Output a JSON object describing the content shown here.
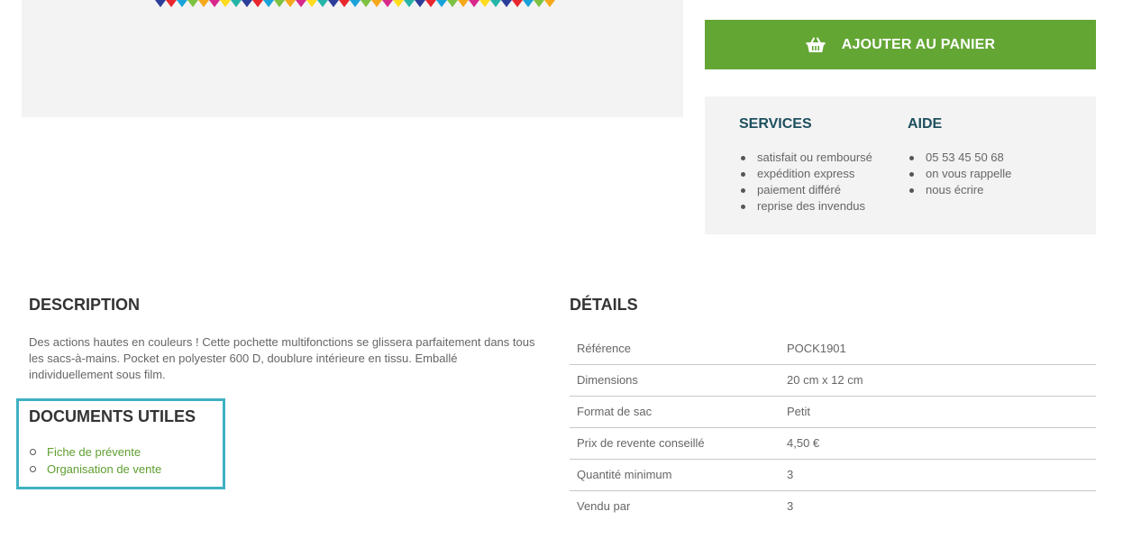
{
  "cart": {
    "label": "AJOUTER AU PANIER",
    "icon": "basket-icon"
  },
  "services": {
    "title": "SERVICES",
    "items": [
      "satisfait ou remboursé",
      "expédition express",
      "paiement différé",
      "reprise des invendus"
    ]
  },
  "aide": {
    "title": "AIDE",
    "items": [
      "05 53 45 50 68",
      "on vous rappelle",
      "nous écrire"
    ]
  },
  "description": {
    "title": "DESCRIPTION",
    "text": "Des actions hautes en couleurs ! Cette pochette multifonctions se glissera parfaitement dans tous les sacs-à-mains. Pocket en polyester 600 D, doublure intérieure en tissu. Emballé individuellement sous film."
  },
  "documents": {
    "title": "DOCUMENTS UTILES",
    "links": [
      "Fiche de prévente",
      "Organisation de vente"
    ]
  },
  "details": {
    "title": "DÉTAILS",
    "rows": [
      {
        "label": "Référence",
        "value": "POCK1901"
      },
      {
        "label": "Dimensions",
        "value": "20 cm x 12 cm"
      },
      {
        "label": "Format de sac",
        "value": "Petit"
      },
      {
        "label": "Prix de revente conseillé",
        "value": "4,50 €"
      },
      {
        "label": "Quantité minimum",
        "value": "3"
      },
      {
        "label": "Vendu par",
        "value": "3"
      }
    ]
  },
  "colors": {
    "accent_green": "#63a634",
    "link_green": "#5e9e2f",
    "heading_blue": "#1d4f5e",
    "highlight_border": "#3fb1c2",
    "panel_bg": "#f4f3f4"
  }
}
